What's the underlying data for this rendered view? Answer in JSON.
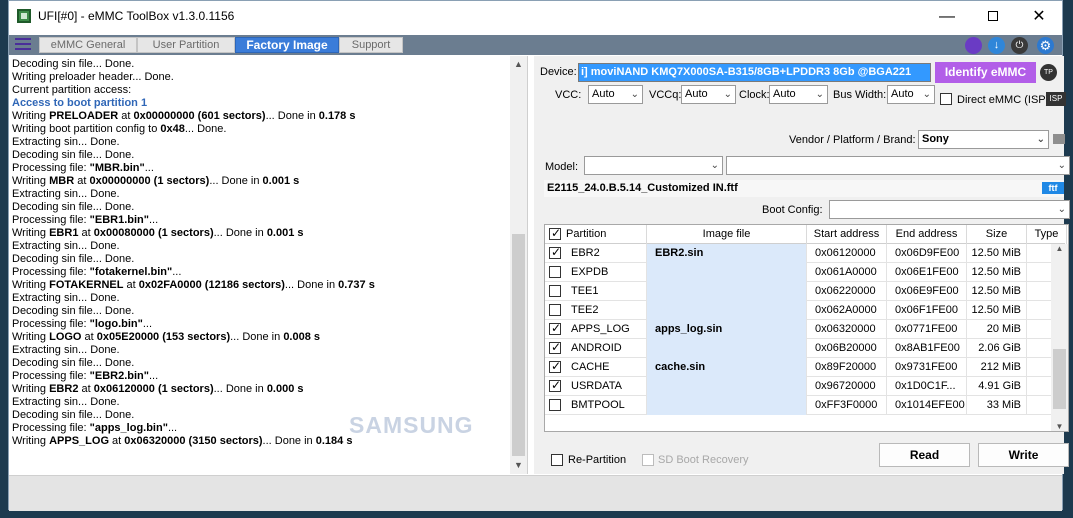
{
  "window": {
    "title": "UFI[#0] - eMMC ToolBox v1.3.0.1156"
  },
  "tabs": [
    {
      "label": "eMMC General",
      "active": false
    },
    {
      "label": "User Partition",
      "active": false
    },
    {
      "label": "Factory Image",
      "active": true
    },
    {
      "label": "Support",
      "active": false
    }
  ],
  "log": [
    {
      "text": "Decoding sin file... Done."
    },
    {
      "text": " Writing preloader header... Done."
    },
    {
      "text": "Current partition access:"
    },
    {
      "text": "  Access to boot partition 1",
      "style": "access"
    },
    {
      "pre": " Writing ",
      "b1": "PRELOADER",
      "mid": " at ",
      "b2": "0x00000000 (601 sectors)",
      "post": "... Done in ",
      "b3": "0.178 s"
    },
    {
      "pre": "Writing boot partition config to ",
      "b1": "0x48",
      "post": "... Done."
    },
    {
      "text": " Extracting sin... Done."
    },
    {
      "text": " Decoding sin file... Done."
    },
    {
      "pre": "Processing file: ",
      "b1": "\"MBR.bin\"",
      "post": "..."
    },
    {
      "pre": " Writing ",
      "b1": "MBR",
      "mid": " at ",
      "b2": "0x00000000 (1 sectors)",
      "post": "... Done in ",
      "b3": "0.001 s"
    },
    {
      "text": " Extracting sin... Done."
    },
    {
      "text": " Decoding sin file... Done."
    },
    {
      "pre": "Processing file: ",
      "b1": "\"EBR1.bin\"",
      "post": "..."
    },
    {
      "pre": " Writing ",
      "b1": "EBR1",
      "mid": " at ",
      "b2": "0x00080000 (1 sectors)",
      "post": "... Done in ",
      "b3": "0.001 s"
    },
    {
      "text": " Extracting sin... Done."
    },
    {
      "text": " Decoding sin file... Done."
    },
    {
      "pre": "Processing file: ",
      "b1": "\"fotakernel.bin\"",
      "post": "..."
    },
    {
      "pre": " Writing ",
      "b1": "FOTAKERNEL",
      "mid": " at ",
      "b2": "0x02FA0000 (12186 sectors)",
      "post": "... Done in ",
      "b3": "0.737 s"
    },
    {
      "text": " Extracting sin... Done."
    },
    {
      "text": " Decoding sin file... Done."
    },
    {
      "pre": "Processing file: ",
      "b1": "\"logo.bin\"",
      "post": "..."
    },
    {
      "pre": " Writing ",
      "b1": "LOGO",
      "mid": " at ",
      "b2": "0x05E20000 (153 sectors)",
      "post": "... Done in ",
      "b3": "0.008 s"
    },
    {
      "text": " Extracting sin... Done."
    },
    {
      "text": " Decoding sin file... Done."
    },
    {
      "pre": "Processing file: ",
      "b1": "\"EBR2.bin\"",
      "post": "..."
    },
    {
      "pre": " Writing ",
      "b1": "EBR2",
      "mid": " at ",
      "b2": "0x06120000 (1 sectors)",
      "post": "... Done in ",
      "b3": "0.000 s"
    },
    {
      "text": " Extracting sin... Done."
    },
    {
      "text": " Decoding sin file... Done."
    },
    {
      "pre": "Processing file: ",
      "b1": "\"apps_log.bin\"",
      "post": "..."
    },
    {
      "pre": " Writing ",
      "b1": "APPS_LOG",
      "mid": " at ",
      "b2": "0x06320000 (3150 sectors)",
      "post": "... Done in ",
      "b3": "0.184 s"
    }
  ],
  "watermark": "SAMSUNG",
  "device": {
    "label": "Device:",
    "value": "i] moviNAND KMQ7X000SA-B315/8GB+LPDDR3 8Gb  @BGA221",
    "identify": "Identify eMMC",
    "tp": "TP"
  },
  "settings": {
    "vcc_label": "VCC:",
    "vcc": "Auto",
    "vccq_label": "VCCq:",
    "vccq": "Auto",
    "clock_label": "Clock:",
    "clock": "Auto",
    "bus_label": "Bus Width:",
    "bus": "Auto",
    "direct_label": "Direct eMMC (ISP)",
    "isp": "ISP"
  },
  "vendor": {
    "label": "Vendor / Platform / Brand:",
    "value": "Sony"
  },
  "model": {
    "label": "Model:",
    "value": "",
    "value2": ""
  },
  "firmware_file": {
    "name": "E2115_24.0.B.5.14_Customized IN.ftf",
    "badge": "ftf"
  },
  "boot_config": {
    "label": "Boot Config:",
    "value": ""
  },
  "grid": {
    "headers": [
      "Partition",
      "Image file",
      "Start address",
      "End address",
      "Size",
      "Type"
    ],
    "rows": [
      {
        "checked": true,
        "partition": "EBR2",
        "image": "EBR2.sin",
        "start": "0x06120000",
        "end": "0x06D9FE00",
        "size": "12.50 MiB"
      },
      {
        "checked": false,
        "partition": "EXPDB",
        "image": "",
        "start": "0x061A0000",
        "end": "0x06E1FE00",
        "size": "12.50 MiB"
      },
      {
        "checked": false,
        "partition": "TEE1",
        "image": "",
        "start": "0x06220000",
        "end": "0x06E9FE00",
        "size": "12.50 MiB"
      },
      {
        "checked": false,
        "partition": "TEE2",
        "image": "",
        "start": "0x062A0000",
        "end": "0x06F1FE00",
        "size": "12.50 MiB"
      },
      {
        "checked": true,
        "partition": "APPS_LOG",
        "image": "apps_log.sin",
        "start": "0x06320000",
        "end": "0x0771FE00",
        "size": "20 MiB"
      },
      {
        "checked": true,
        "partition": "ANDROID",
        "image": "",
        "start": "0x06B20000",
        "end": "0x8AB1FE00",
        "size": "2.06 GiB"
      },
      {
        "checked": true,
        "partition": "CACHE",
        "image": "cache.sin",
        "start": "0x89F20000",
        "end": "0x9731FE00",
        "size": "212 MiB"
      },
      {
        "checked": true,
        "partition": "USRDATA",
        "image": "",
        "start": "0x96720000",
        "end": "0x1D0C1F...",
        "size": "4.91 GiB"
      },
      {
        "checked": false,
        "partition": "BMTPOOL",
        "image": "",
        "start": "0xFF3F0000",
        "end": "0x1014EFE00",
        "size": "33 MiB"
      }
    ]
  },
  "actions": {
    "repartition": "Re-Partition",
    "sd_boot": "SD Boot Recovery",
    "read": "Read",
    "write": "Write"
  }
}
